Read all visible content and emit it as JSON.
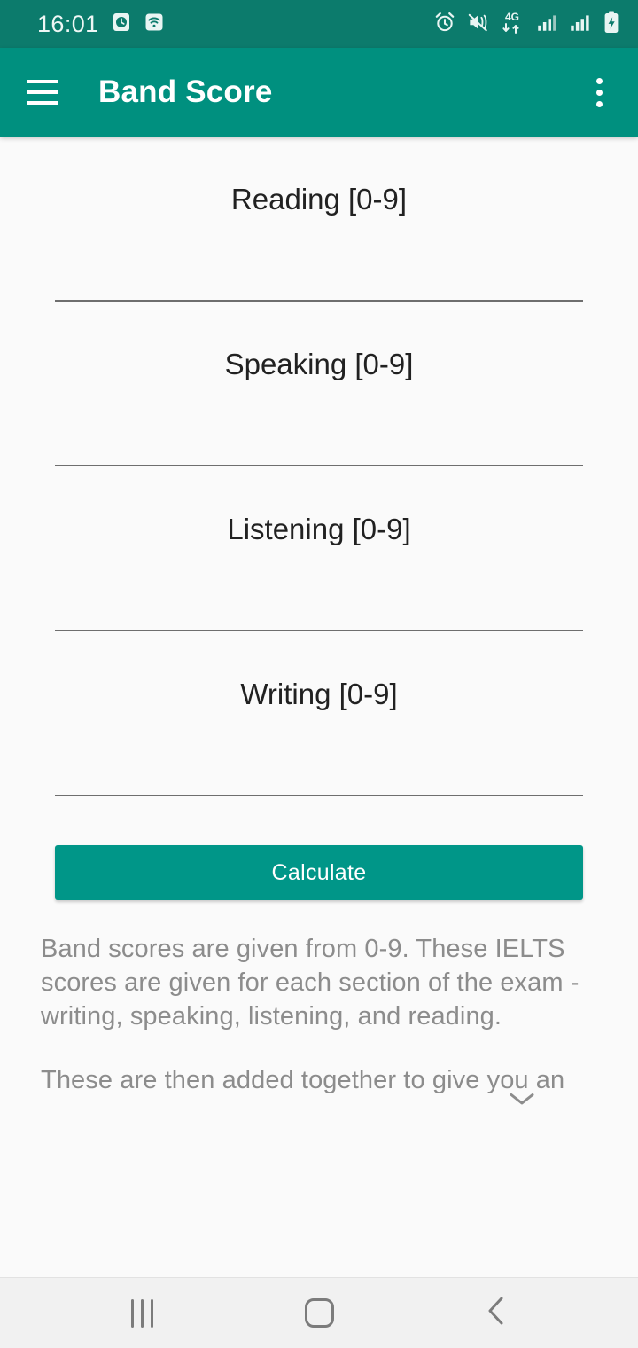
{
  "status_bar": {
    "time": "16:01",
    "left_icons": [
      "clock-square-icon",
      "wifi-icon"
    ],
    "right_icons": [
      "alarm-icon",
      "mute-vibrate-icon",
      "4g-data-icon",
      "signal-sim1-icon",
      "signal-sim2-icon",
      "battery-charging-icon"
    ],
    "network_label": "4G",
    "background_color": "#0c7b6c"
  },
  "app_bar": {
    "title": "Band Score",
    "menu_icon": "hamburger-menu-icon",
    "overflow_icon": "overflow-menu-icon",
    "background_color": "#00907f"
  },
  "form": {
    "fields": [
      {
        "name": "reading",
        "placeholder": "Reading [0-9]",
        "value": ""
      },
      {
        "name": "speaking",
        "placeholder": "Speaking [0-9]",
        "value": ""
      },
      {
        "name": "listening",
        "placeholder": "Listening [0-9]",
        "value": ""
      },
      {
        "name": "writing",
        "placeholder": "Writing [0-9]",
        "value": ""
      }
    ],
    "calculate_label": "Calculate",
    "calculate_color": "#009688"
  },
  "description": {
    "paragraph1": "Band scores are given from 0-9. These IELTS scores are given for each section of the exam - writing, speaking, listening, and reading.",
    "paragraph2": "These are then added together to give you an",
    "expand_icon": "chevron-down-icon",
    "text_color": "#8c8c8c"
  },
  "nav_bar": {
    "recents_label": "recents-icon",
    "home_label": "home-icon",
    "back_label": "back-icon",
    "background_color": "#f1f1f1"
  }
}
